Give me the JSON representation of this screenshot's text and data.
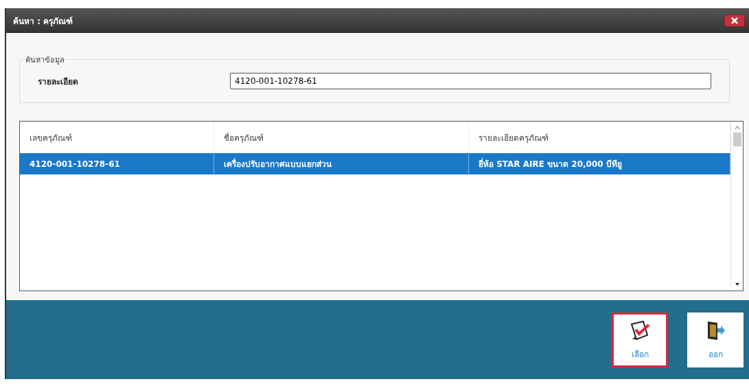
{
  "window": {
    "title": "ค้นหา : ครุภัณฑ์"
  },
  "search_group": {
    "legend": "ค้นหาข้อมูล",
    "label": "รายละเอียด",
    "value": "4120-001-10278-61"
  },
  "table": {
    "columns": [
      "เลขครุภัณฑ์",
      "ชื่อครุภัณฑ์",
      "รายละเอียดครุภัณฑ์"
    ],
    "rows": [
      {
        "cells": [
          "4120-001-10278-61",
          "เครื่องปรับอากาศแบบแยกส่วน",
          "ยี่ห้อ STAR AIRE ขนาด 20,000 บีทียู"
        ],
        "selected": true
      }
    ]
  },
  "buttons": [
    {
      "kind": "select",
      "label": "เลือก",
      "focused": true
    },
    {
      "kind": "exit",
      "label": "ออก",
      "focused": false
    }
  ]
}
